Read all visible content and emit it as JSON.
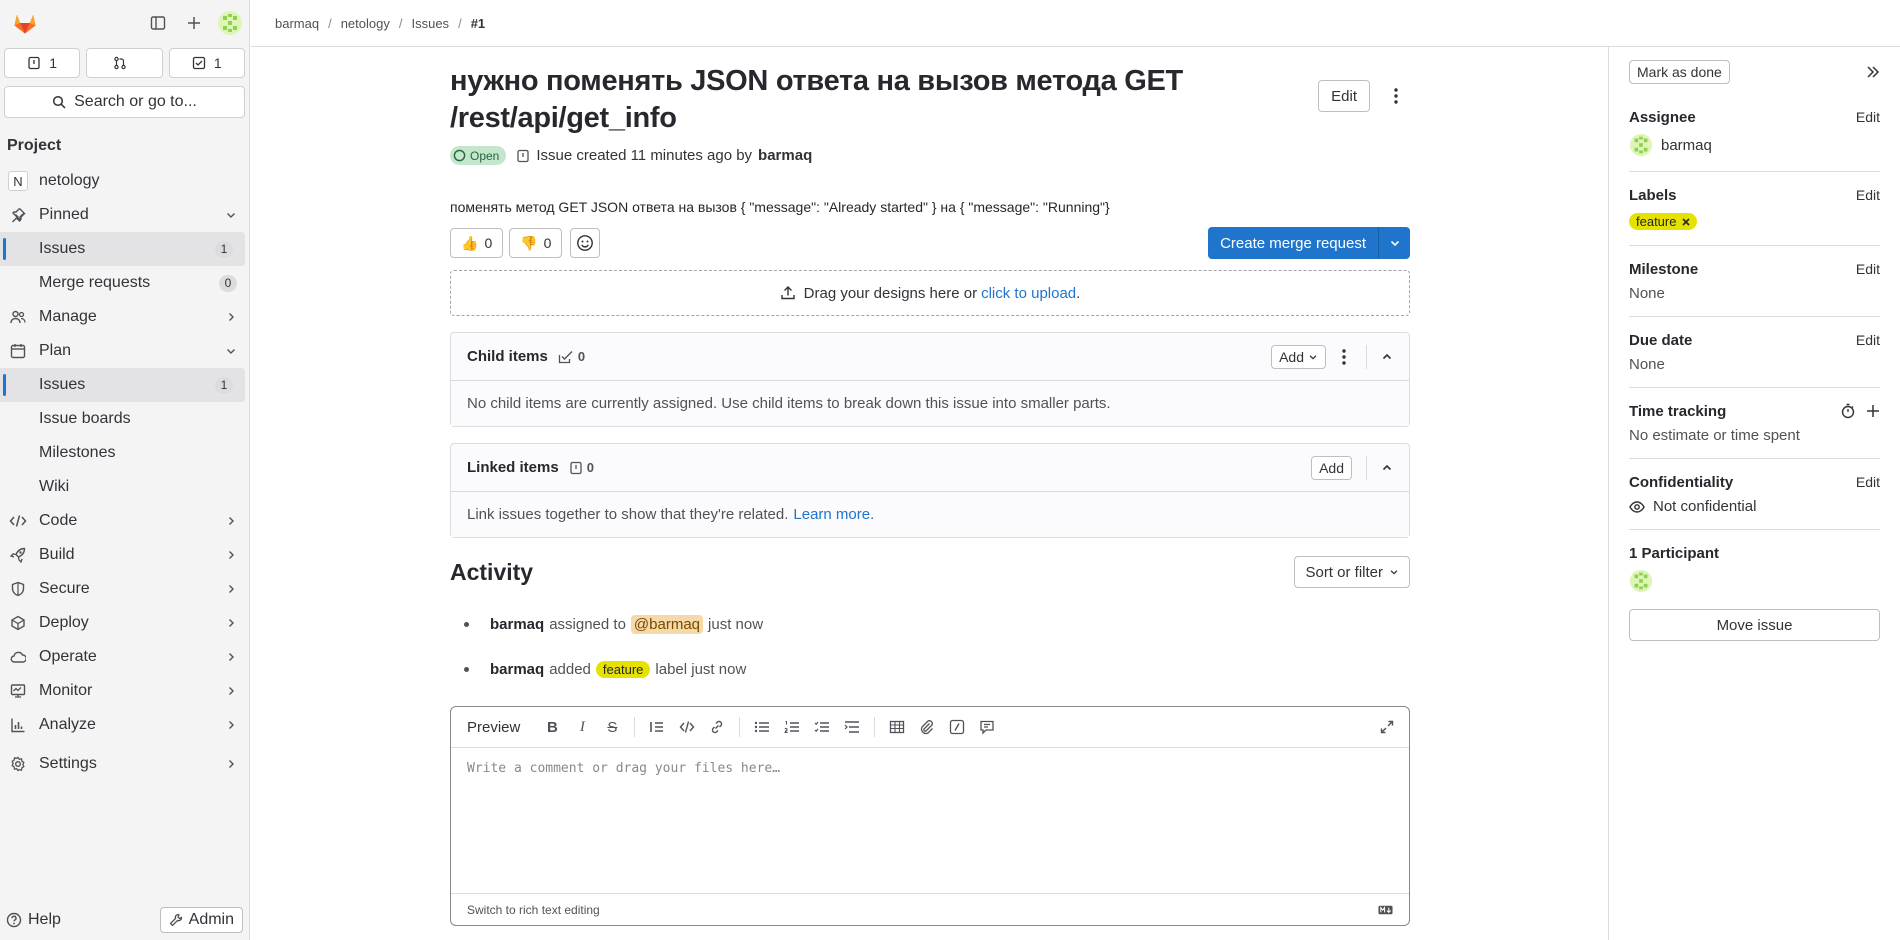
{
  "sidebar": {
    "counters": [
      {
        "icon": "issues-icon",
        "count": "1"
      },
      {
        "icon": "merge-request-icon",
        "count": ""
      },
      {
        "icon": "todo-icon",
        "count": "1"
      }
    ],
    "search_label": "Search or go to...",
    "section_title": "Project",
    "project_initial": "N",
    "project_name": "netology",
    "pinned_label": "Pinned",
    "pinned_items": [
      {
        "label": "Issues",
        "count": "1"
      },
      {
        "label": "Merge requests",
        "count": "0"
      }
    ],
    "manage_label": "Manage",
    "plan_label": "Plan",
    "plan_items": [
      {
        "label": "Issues",
        "count": "1"
      },
      {
        "label": "Issue boards"
      },
      {
        "label": "Milestones"
      },
      {
        "label": "Wiki"
      }
    ],
    "groups": [
      "Code",
      "Build",
      "Secure",
      "Deploy",
      "Operate",
      "Monitor",
      "Analyze",
      "Settings"
    ],
    "help_label": "Help",
    "admin_label": "Admin"
  },
  "breadcrumb": [
    "barmaq",
    "netology",
    "Issues",
    "#1"
  ],
  "issue": {
    "title": "нужно поменять JSON ответа на вызов метода GET /rest/api/get_info",
    "edit_label": "Edit",
    "status": "Open",
    "created_text": "Issue created 11 minutes ago by",
    "author": "barmaq",
    "description": "поменять метод GET JSON ответа на вызов { \"message\": \"Already started\" } на { \"message\": \"Running\"}",
    "thumbs_up": "0",
    "thumbs_down": "0",
    "create_mr_label": "Create merge request",
    "upload_text": "Drag your designs here or",
    "upload_link": "click to upload",
    "upload_end": "."
  },
  "child_items": {
    "title": "Child items",
    "count": "0",
    "add_label": "Add",
    "empty_text": "No child items are currently assigned. Use child items to break down this issue into smaller parts."
  },
  "linked_items": {
    "title": "Linked items",
    "count": "0",
    "add_label": "Add",
    "text": "Link issues together to show that they're related.",
    "link": "Learn more."
  },
  "activity": {
    "title": "Activity",
    "sort_label": "Sort or filter",
    "events": [
      {
        "user": "barmaq",
        "pre": "assigned to",
        "mention": "@barmaq",
        "post": "just now"
      },
      {
        "user": "barmaq",
        "pre": "added",
        "label": "feature",
        "post": "label just now"
      }
    ]
  },
  "editor": {
    "preview_label": "Preview",
    "placeholder": "Write a comment or drag your files here…",
    "switch_label": "Switch to rich text editing"
  },
  "right_sidebar": {
    "mark_done_label": "Mark as done",
    "edit_label": "Edit",
    "assignee_title": "Assignee",
    "assignee": "barmaq",
    "labels_title": "Labels",
    "label": "feature",
    "milestone_title": "Milestone",
    "milestone": "None",
    "due_title": "Due date",
    "due": "None",
    "time_title": "Time tracking",
    "time": "No estimate or time spent",
    "conf_title": "Confidentiality",
    "conf": "Not confidential",
    "participants_title": "1 Participant",
    "move_label": "Move issue"
  },
  "colors": {
    "accent": "#1f75cb",
    "label_feature": "#e6e200",
    "status_open": "#c3e6cd"
  }
}
